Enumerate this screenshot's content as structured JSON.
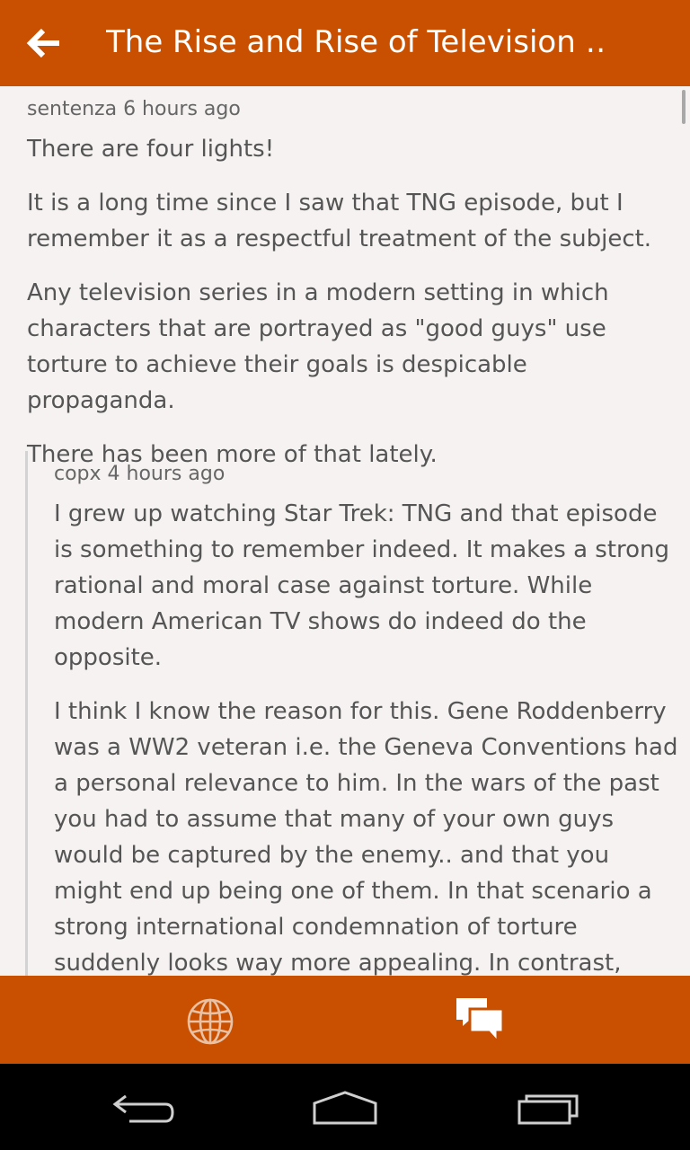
{
  "header": {
    "title": "The Rise and Rise of Television …",
    "back_icon": "arrow-left-icon",
    "color": "#c85000"
  },
  "comment": {
    "meta": "sentenza 6 hours ago",
    "paragraphs": [
      "There are four lights!",
      "It is a long time since I saw that TNG episode, but I remember it as a respectful treatment of the subject.",
      "Any television series in a modern setting in which characters that are portrayed as \"good guys\" use torture to achieve their goals is despicable propaganda.",
      "There has been more of that lately."
    ]
  },
  "reply": {
    "meta": "copx 4 hours ago",
    "paragraphs": [
      "I grew up watching Star Trek: TNG and that episode is something to remember indeed. It makes a strong rational and moral case against torture. While modern American TV shows do indeed do the opposite.",
      "I think I know the reason for this. Gene Roddenberry was a WW2 veteran i.e. the Geneva Conventions had a personal relevance to him. In the wars of the past you had to assume that many of your own guys would be captured by the enemy.. and that you might end up being one of them. In that scenario a strong international condemnation of torture suddenly looks way more appealing. In contrast,"
    ]
  },
  "bottom_bar": {
    "icons": [
      "globe-icon",
      "chat-bubbles-icon"
    ]
  },
  "system_nav": {
    "icons": [
      "back-icon",
      "home-icon",
      "recents-icon"
    ]
  }
}
